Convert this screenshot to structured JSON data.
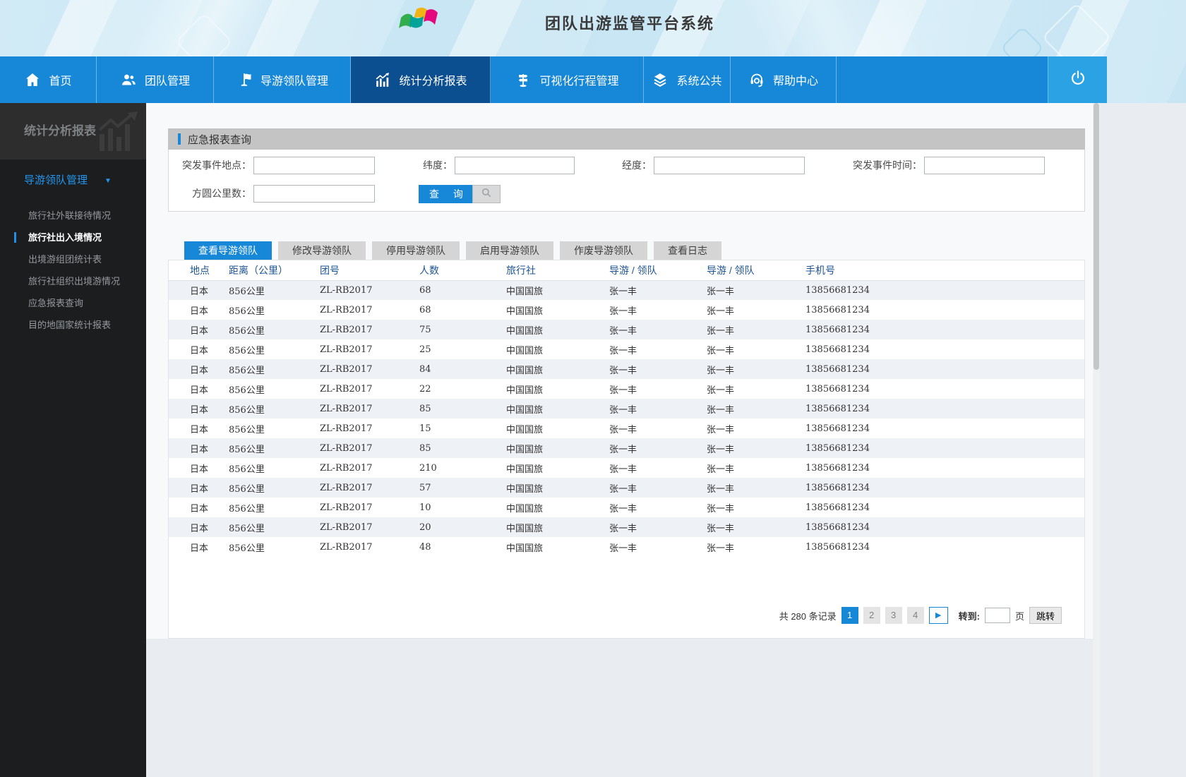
{
  "header": {
    "title": "团队出游监管平台系统"
  },
  "nav": {
    "items": [
      {
        "label": "首页",
        "icon": "home-icon",
        "active": false
      },
      {
        "label": "团队管理",
        "icon": "team-icon",
        "active": false
      },
      {
        "label": "导游领队管理",
        "icon": "flag-icon",
        "active": false
      },
      {
        "label": "统计分析报表",
        "icon": "bar-chart-icon",
        "active": true
      },
      {
        "label": "可视化行程管理",
        "icon": "signpost-icon",
        "active": false
      },
      {
        "label": "系统公共",
        "icon": "layers-icon",
        "active": false
      },
      {
        "label": "帮助中心",
        "icon": "headset-icon",
        "active": false
      }
    ],
    "power_icon": "power-icon"
  },
  "sidebar": {
    "section_title": "统计分析报表",
    "group_label": "导游领队管理",
    "group_arrow": "▼",
    "items": [
      {
        "label": "旅行社外联接待情况",
        "active": false
      },
      {
        "label": "旅行社出入境情况",
        "active": true
      },
      {
        "label": "出境游组团统计表",
        "active": false
      },
      {
        "label": "旅行社组织出境游情况",
        "active": false
      },
      {
        "label": "应急报表查询",
        "active": false
      },
      {
        "label": "目的地国家统计报表",
        "active": false
      }
    ]
  },
  "query_panel": {
    "title": "应急报表查询",
    "fields": [
      {
        "label": "突发事件地点：",
        "value": ""
      },
      {
        "label": "纬度：",
        "value": ""
      },
      {
        "label": "经度：",
        "value": ""
      },
      {
        "label": "突发事件时间：",
        "value": ""
      },
      {
        "label": "方圆公里数：",
        "value": ""
      }
    ],
    "search_label": "查 询",
    "search_icon": "search-icon"
  },
  "tabs": [
    {
      "label": "查看导游领队",
      "active": true
    },
    {
      "label": "修改导游领队",
      "active": false
    },
    {
      "label": "停用导游领队",
      "active": false
    },
    {
      "label": "启用导游领队",
      "active": false
    },
    {
      "label": "作废导游领队",
      "active": false
    },
    {
      "label": "查看日志",
      "active": false
    }
  ],
  "table": {
    "columns": [
      "地点",
      "距离（公里）",
      "团号",
      "人数",
      "旅行社",
      "导游 / 领队",
      "导游 / 领队",
      "手机号"
    ],
    "rows": [
      [
        "日本",
        "856公里",
        "ZL-RB2017",
        "68",
        "中国国旅",
        "张一丰",
        "张一丰",
        "13856681234"
      ],
      [
        "日本",
        "856公里",
        "ZL-RB2017",
        "68",
        "中国国旅",
        "张一丰",
        "张一丰",
        "13856681234"
      ],
      [
        "日本",
        "856公里",
        "ZL-RB2017",
        "75",
        "中国国旅",
        "张一丰",
        "张一丰",
        "13856681234"
      ],
      [
        "日本",
        "856公里",
        "ZL-RB2017",
        "25",
        "中国国旅",
        "张一丰",
        "张一丰",
        "13856681234"
      ],
      [
        "日本",
        "856公里",
        "ZL-RB2017",
        "84",
        "中国国旅",
        "张一丰",
        "张一丰",
        "13856681234"
      ],
      [
        "日本",
        "856公里",
        "ZL-RB2017",
        "22",
        "中国国旅",
        "张一丰",
        "张一丰",
        "13856681234"
      ],
      [
        "日本",
        "856公里",
        "ZL-RB2017",
        "85",
        "中国国旅",
        "张一丰",
        "张一丰",
        "13856681234"
      ],
      [
        "日本",
        "856公里",
        "ZL-RB2017",
        "15",
        "中国国旅",
        "张一丰",
        "张一丰",
        "13856681234"
      ],
      [
        "日本",
        "856公里",
        "ZL-RB2017",
        "85",
        "中国国旅",
        "张一丰",
        "张一丰",
        "13856681234"
      ],
      [
        "日本",
        "856公里",
        "ZL-RB2017",
        "210",
        "中国国旅",
        "张一丰",
        "张一丰",
        "13856681234"
      ],
      [
        "日本",
        "856公里",
        "ZL-RB2017",
        "57",
        "中国国旅",
        "张一丰",
        "张一丰",
        "13856681234"
      ],
      [
        "日本",
        "856公里",
        "ZL-RB2017",
        "10",
        "中国国旅",
        "张一丰",
        "张一丰",
        "13856681234"
      ],
      [
        "日本",
        "856公里",
        "ZL-RB2017",
        "20",
        "中国国旅",
        "张一丰",
        "张一丰",
        "13856681234"
      ],
      [
        "日本",
        "856公里",
        "ZL-RB2017",
        "48",
        "中国国旅",
        "张一丰",
        "张一丰",
        "13856681234"
      ]
    ]
  },
  "pagination": {
    "records_label": "共 280 条记录",
    "pages": [
      "1",
      "2",
      "3",
      "4"
    ],
    "active_page": "1",
    "next_icon": "▶",
    "goto_label": "转到:",
    "goto_value": "",
    "page_unit": "页",
    "jump_label": "跳转"
  },
  "colors": {
    "nav_blue": "#1787d8",
    "nav_active": "#0b4f90",
    "accent_blue": "#1787d8",
    "sidebar_dark": "#1b1d1f",
    "row_stripe": "#eef1f6"
  }
}
